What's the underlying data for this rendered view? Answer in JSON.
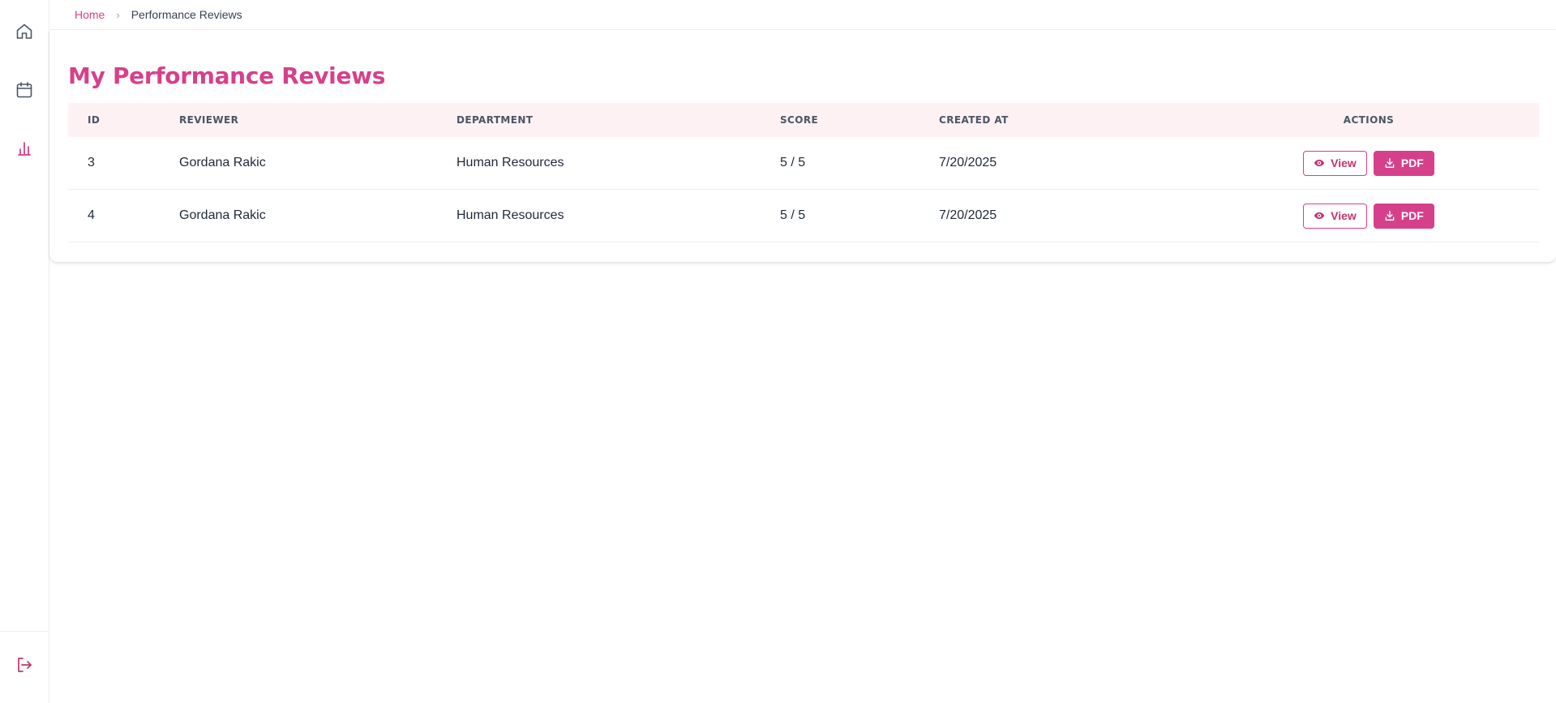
{
  "breadcrumb": {
    "home": "Home",
    "separator": "›",
    "current": "Performance Reviews"
  },
  "page": {
    "title": "My Performance Reviews"
  },
  "table": {
    "columns": [
      "ID",
      "REVIEWER",
      "DEPARTMENT",
      "SCORE",
      "CREATED AT",
      "ACTIONS"
    ],
    "rows": [
      {
        "id": "3",
        "reviewer": "Gordana Rakic",
        "department": "Human Resources",
        "score": "5 / 5",
        "created_at": "7/20/2025"
      },
      {
        "id": "4",
        "reviewer": "Gordana Rakic",
        "department": "Human Resources",
        "score": "5 / 5",
        "created_at": "7/20/2025"
      }
    ],
    "actions": {
      "view_label": "View",
      "pdf_label": "PDF"
    }
  },
  "sidebar": {
    "items": [
      {
        "icon": "home-icon"
      },
      {
        "icon": "calendar-icon"
      },
      {
        "icon": "bar-chart-icon",
        "active": true
      }
    ],
    "footer_icon": "logout-icon"
  },
  "colors": {
    "accent": "#d6408b",
    "header_bg": "#fdf1f4",
    "icon_gray": "#4b5563"
  }
}
